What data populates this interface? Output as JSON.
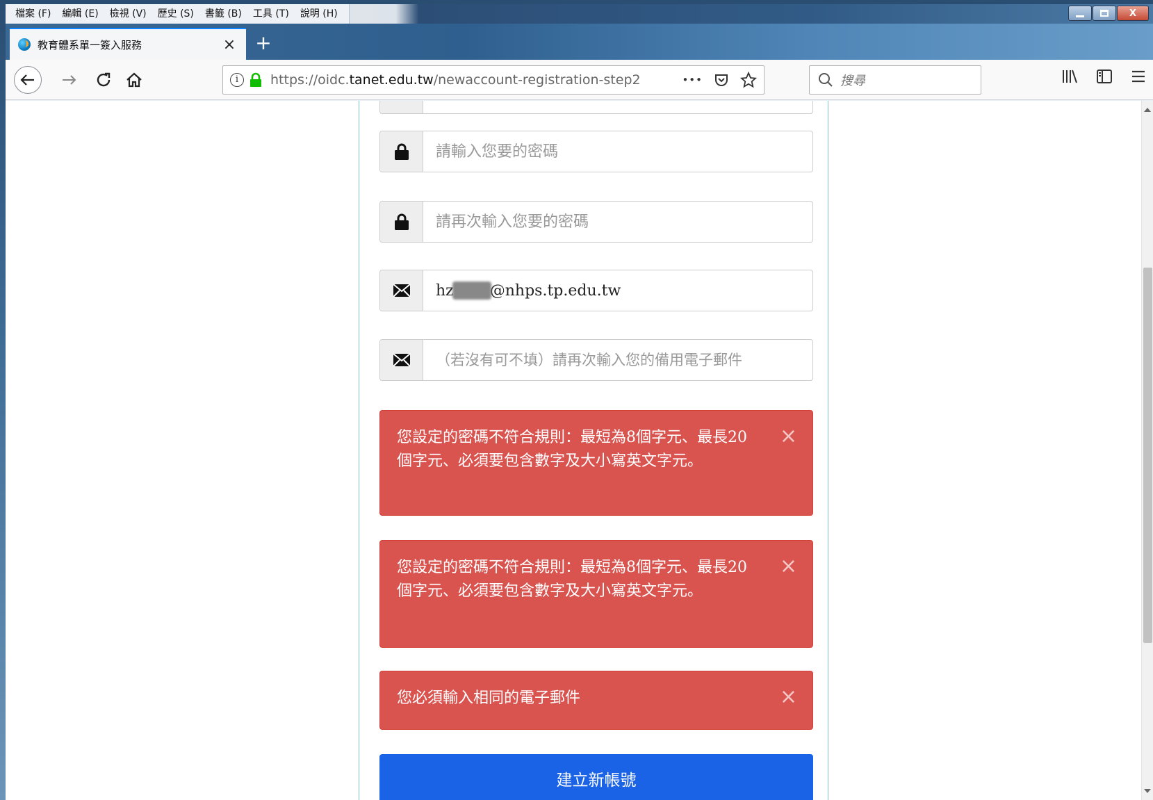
{
  "menubar": {
    "items": [
      "檔案 (F)",
      "編輯 (E)",
      "檢視 (V)",
      "歷史 (S)",
      "書籤 (B)",
      "工具 (T)",
      "說明 (H)"
    ]
  },
  "tab": {
    "title": "教育體系單一簽入服務",
    "close": "×",
    "new_tab": "+"
  },
  "navbar": {
    "url_host": "https://oidc.",
    "url_domain": "tanet.edu.tw",
    "url_path": "/newaccount-registration-step2",
    "search_placeholder": "搜尋",
    "more_actions": "•••"
  },
  "form": {
    "password_placeholder": "請輸入您要的密碼",
    "password_confirm_placeholder": "請再次輸入您要的密碼",
    "email_prefix": "hz",
    "email_suffix": "@nhps.tp.edu.tw",
    "email_confirm_placeholder": "（若沒有可不填）請再次輸入您的備用電子郵件"
  },
  "alerts": [
    {
      "text": "您設定的密碼不符合規則：最短為8個字元、最長20個字元、必須要包含數字及大小寫英文字元。",
      "close": "×"
    },
    {
      "text": "您設定的密碼不符合規則：最短為8個字元、最長20個字元、必須要包含數字及大小寫英文字元。",
      "close": "×"
    },
    {
      "text": "您必須輸入相同的電子郵件",
      "close": "×"
    }
  ],
  "submit_label": "建立新帳號",
  "colors": {
    "alert_bg": "#d9534f",
    "submit_bg": "#1a63e6",
    "tab_accent": "#0a84ff",
    "lock_green": "#12bc00"
  }
}
